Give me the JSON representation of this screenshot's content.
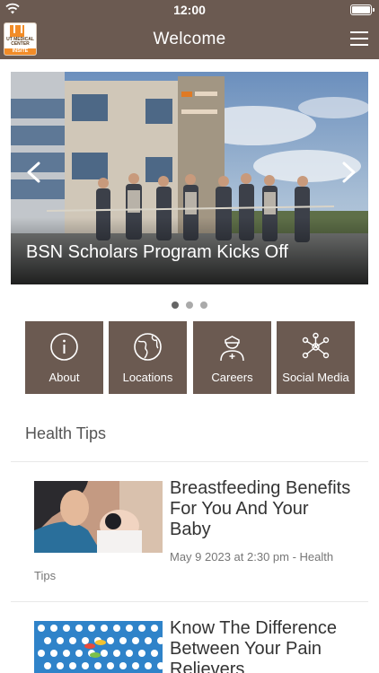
{
  "status_bar": {
    "time": "12:00"
  },
  "header": {
    "title": "Welcome",
    "logo_text": "UT MEDICAL CENTER",
    "logo_badge": "INSITE"
  },
  "carousel": {
    "slide_caption": "BSN Scholars Program Kicks Off",
    "dot_count": 3,
    "active_index": 0
  },
  "tiles": [
    {
      "label": "About",
      "icon": "info-icon"
    },
    {
      "label": "Locations",
      "icon": "globe-icon"
    },
    {
      "label": "Careers",
      "icon": "nurse-icon"
    },
    {
      "label": "Social Media",
      "icon": "network-icon"
    }
  ],
  "health_tips": {
    "heading": "Health Tips",
    "articles": [
      {
        "title": "Breastfeeding Benefits For You And Your Baby",
        "meta_line1": "May 9 2023 at 2:30 pm - Health",
        "meta_line2": "Tips"
      },
      {
        "title": "Know The Difference Between Your Pain Relievers"
      }
    ]
  },
  "colors": {
    "brand_brown": "#6b5a51",
    "brand_orange": "#f28c28"
  }
}
